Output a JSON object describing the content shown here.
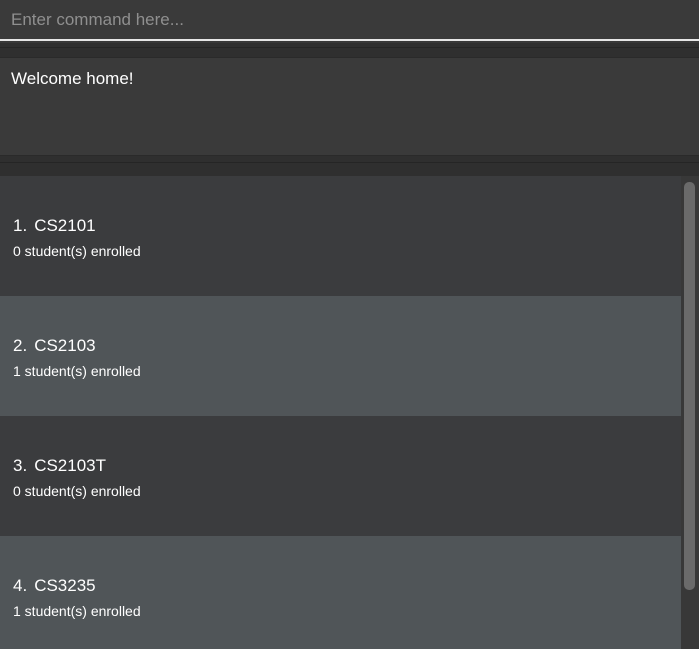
{
  "command": {
    "placeholder": "Enter command here...",
    "value": ""
  },
  "result": {
    "text": "Welcome home!"
  },
  "modules": [
    {
      "index": "1.",
      "code": "CS2101",
      "enrolled": "0 student(s) enrolled"
    },
    {
      "index": "2.",
      "code": "CS2103",
      "enrolled": "1 student(s) enrolled"
    },
    {
      "index": "3.",
      "code": "CS2103T",
      "enrolled": "0 student(s) enrolled"
    },
    {
      "index": "4.",
      "code": "CS3235",
      "enrolled": "1 student(s) enrolled"
    }
  ],
  "colors": {
    "background": "#383838",
    "card_dark": "#3b3c3e",
    "card_light": "#505558",
    "text": "#ffffff",
    "placeholder": "#8f8f8f"
  }
}
